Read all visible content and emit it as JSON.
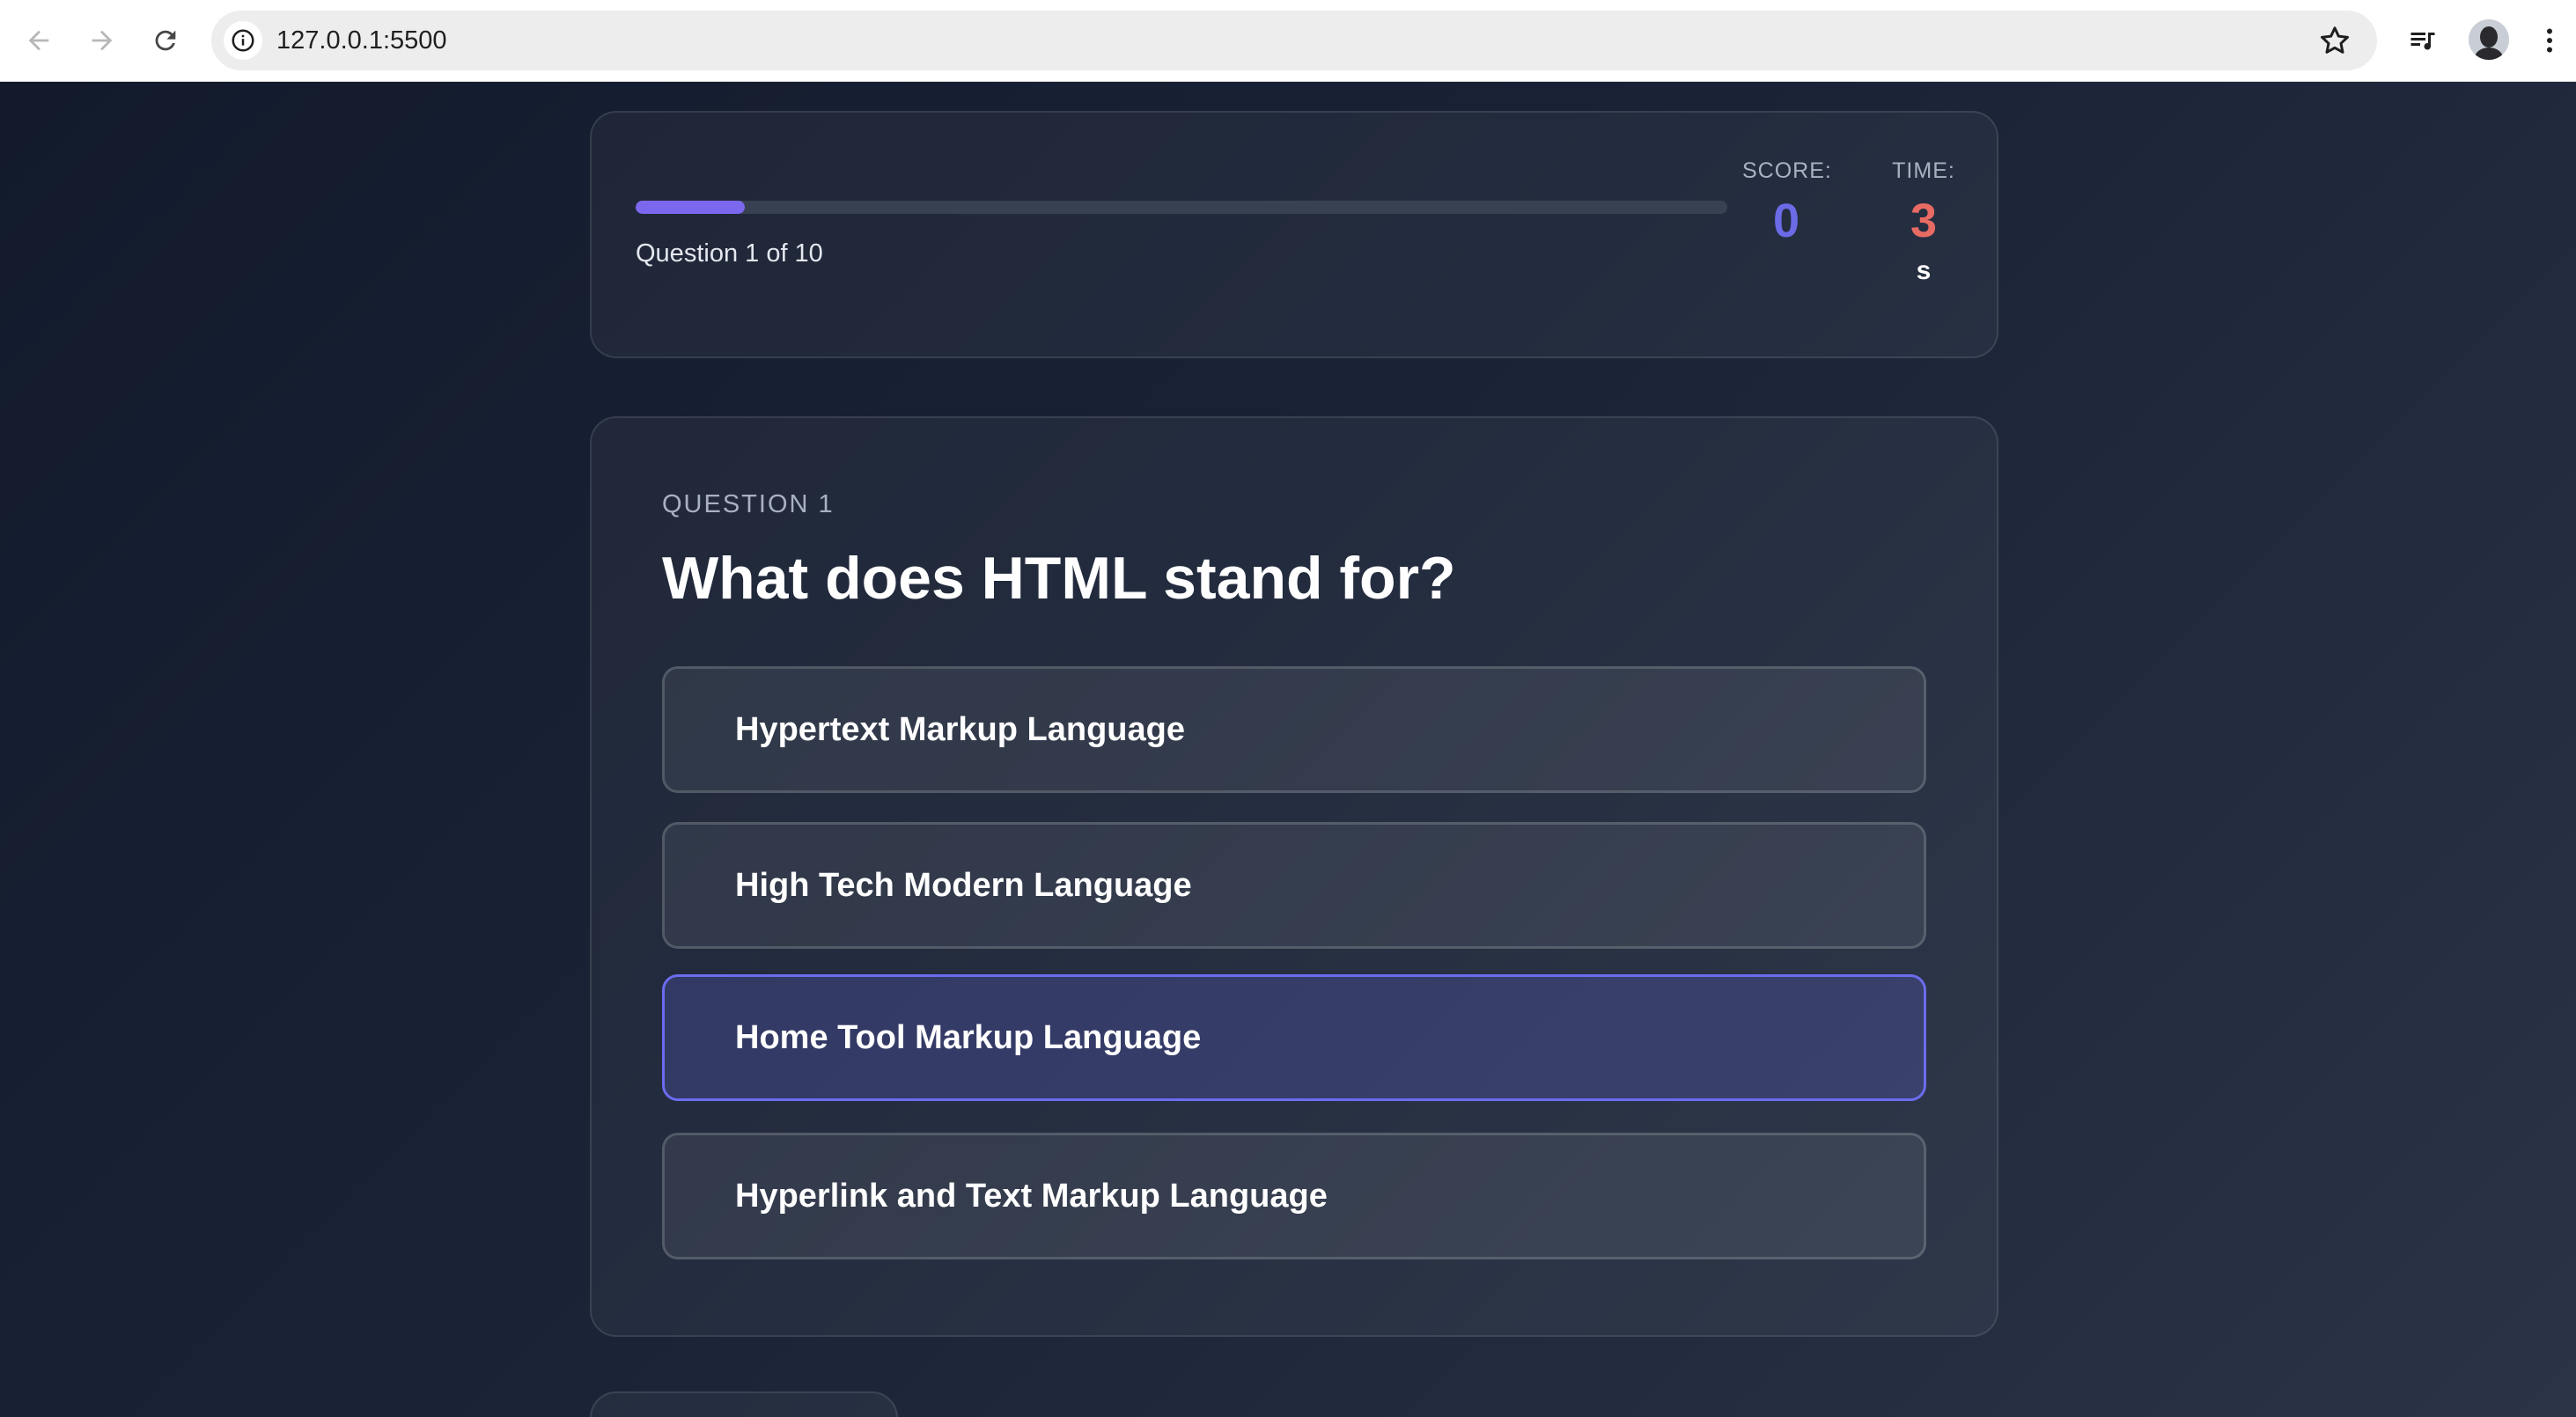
{
  "browser": {
    "url": "127.0.0.1:5500",
    "icons": {
      "back": "arrow-left-icon",
      "forward": "arrow-right-icon",
      "reload": "reload-icon",
      "site_info": "info-icon",
      "bookmark": "star-icon",
      "media": "media-queue-icon",
      "profile": "avatar",
      "menu": "kebab-menu-icon"
    }
  },
  "status": {
    "progress_fraction": 0.1,
    "progress_text": "Question 1 of 10",
    "score_label": "SCORE:",
    "score_value": "0",
    "time_label": "TIME:",
    "time_value": "3",
    "time_unit": "s"
  },
  "question": {
    "number_label": "QUESTION 1",
    "title": "What does HTML stand for?",
    "options": [
      {
        "label": "Hypertext Markup Language",
        "selected": false
      },
      {
        "label": "High Tech Modern Language",
        "selected": false
      },
      {
        "label": "Home Tool Markup Language",
        "selected": true
      },
      {
        "label": "Hyperlink and Text Markup Language",
        "selected": false
      }
    ]
  },
  "colors": {
    "accent": "#6c6cf0",
    "progress": "#7b68ee",
    "score": "#6b6be8",
    "time": "#e86b63",
    "background": "#1a2336"
  }
}
